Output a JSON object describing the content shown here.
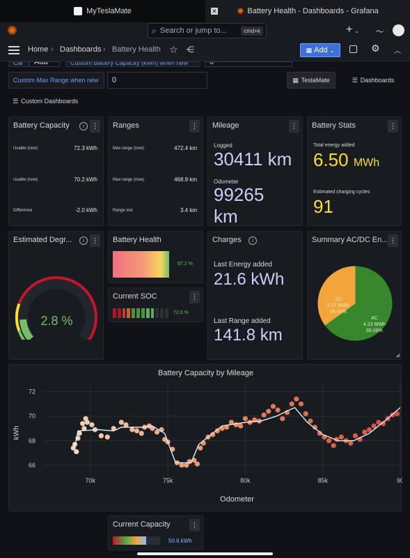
{
  "browser": {
    "tabs": [
      {
        "title": "MyTeslaMate"
      },
      {
        "title": "Battery Health - Dashboards - Grafana"
      }
    ]
  },
  "topnav": {
    "search_placeholder": "Search or jump to...",
    "search_shortcut": "cmd+k",
    "plus": "+"
  },
  "breadcrumb": {
    "home": "Home",
    "dashboards": "Dashboards",
    "current": "Battery Health",
    "add_label": "Add"
  },
  "variables": {
    "partial_label_1": "Car",
    "partial_value_1": "Ada",
    "partial_label_2": "Custom Battery Capacity (kWh) when new",
    "partial_value_2": "0",
    "max_range_label": "Custom Max Range when new",
    "max_range_value": "0",
    "teslamate_link": "TeslaMate",
    "dashboards_link": "Dashboards",
    "custom_dashboards": "Custom Dashboards"
  },
  "battery_capacity": {
    "title": "Battery Capacity",
    "rows": [
      {
        "label": "Usable (new)",
        "value": "72.3 kWh"
      },
      {
        "label": "Usable (now)",
        "value": "70.2 kWh"
      },
      {
        "label": "Difference",
        "value": "-2.0 kWh"
      }
    ]
  },
  "ranges": {
    "title": "Ranges",
    "rows": [
      {
        "label": "Max range (new)",
        "value": "472.4 km"
      },
      {
        "label": "Max range (now)",
        "value": "468.9 km"
      },
      {
        "label": "Range lost",
        "value": "3.4 km"
      }
    ]
  },
  "mileage": {
    "title": "Mileage",
    "logged_label": "Logged",
    "logged_value": "30411 km",
    "odometer_label": "Odometer",
    "odometer_value_1": "99265",
    "odometer_value_2": "km"
  },
  "battery_stats": {
    "title": "Battery Stats",
    "energy_label": "Total energy added",
    "energy_value": "6.50",
    "energy_unit": "MWh",
    "cycles_label": "Estimated charging cycles",
    "cycles_value": "91"
  },
  "degradation": {
    "title": "Estimated Degr...",
    "value": "2.8 %",
    "percent": 2.8
  },
  "battery_health": {
    "title": "Battery Health",
    "value": "97.2 %",
    "percent": 97.2
  },
  "current_soc": {
    "title": "Current SOC",
    "value": "72.0 %",
    "percent": 72.0
  },
  "charges": {
    "title": "Charges",
    "energy_label": "Last Energy added",
    "energy_value": "21.6 kWh",
    "range_label": "Last Range added",
    "range_value": "141.8 km"
  },
  "summary": {
    "title": "Summary AC/DC En...",
    "slices": [
      {
        "name": "AC",
        "value": "4.23 MWh",
        "pct_label": "65.08%",
        "pct": 65.08,
        "color": "#37872d"
      },
      {
        "name": "DC",
        "value": "2.27 MWh",
        "pct_label": "34.92%",
        "pct": 34.92,
        "color": "#f2a53a"
      }
    ]
  },
  "current_capacity": {
    "title": "Current Capacity",
    "value": "50.6 kWh",
    "fraction": 0.7
  },
  "chart_data": {
    "type": "scatter",
    "title": "Battery Capacity by Mileage",
    "xlabel": "Odometer",
    "ylabel": "kWh",
    "x_unit": "km",
    "xlim": [
      67000,
      90000
    ],
    "ylim": [
      65.2,
      72.6
    ],
    "xticks": [
      {
        "v": 70000,
        "label": "70k"
      },
      {
        "v": 75000,
        "label": "75k"
      },
      {
        "v": 80000,
        "label": "80k"
      },
      {
        "v": 85000,
        "label": "85k"
      },
      {
        "v": 90000,
        "label": "90"
      }
    ],
    "yticks": [
      66,
      68,
      70,
      72
    ],
    "grid": true,
    "series": [
      {
        "type": "scatter",
        "points": [
          [
            68900,
            67.4
          ],
          [
            69000,
            67.7
          ],
          [
            69100,
            67.1
          ],
          [
            69200,
            68.2
          ],
          [
            69300,
            68.6
          ],
          [
            69500,
            69.4
          ],
          [
            69600,
            69.0
          ],
          [
            69700,
            69.8
          ],
          [
            69800,
            69.5
          ],
          [
            70100,
            69.3
          ],
          [
            70300,
            68.9
          ],
          [
            70700,
            68.4
          ],
          [
            71100,
            68.3
          ],
          [
            71500,
            69.0
          ],
          [
            72000,
            69.5
          ],
          [
            72300,
            69.3
          ],
          [
            72700,
            68.9
          ],
          [
            73000,
            68.8
          ],
          [
            73300,
            68.6
          ],
          [
            73500,
            69.1
          ],
          [
            73800,
            69.2
          ],
          [
            74000,
            69.0
          ],
          [
            74300,
            68.7
          ],
          [
            74600,
            68.9
          ],
          [
            74800,
            68.1
          ],
          [
            75000,
            67.9
          ],
          [
            75300,
            67.3
          ],
          [
            75600,
            66.2
          ],
          [
            75900,
            66.0
          ],
          [
            76200,
            66.0
          ],
          [
            76400,
            66.3
          ],
          [
            76700,
            66.4
          ],
          [
            76900,
            66.1
          ],
          [
            77100,
            67.4
          ],
          [
            77300,
            67.8
          ],
          [
            77600,
            68.3
          ],
          [
            77900,
            68.5
          ],
          [
            78200,
            68.8
          ],
          [
            78500,
            69.0
          ],
          [
            78800,
            69.1
          ],
          [
            79100,
            69.5
          ],
          [
            79400,
            69.3
          ],
          [
            79700,
            69.2
          ],
          [
            80000,
            69.8
          ],
          [
            80300,
            69.5
          ],
          [
            80600,
            69.7
          ],
          [
            80900,
            69.6
          ],
          [
            81200,
            70.1
          ],
          [
            81500,
            70.4
          ],
          [
            81800,
            70.8
          ],
          [
            82100,
            70.5
          ],
          [
            82400,
            69.8
          ],
          [
            82700,
            70.3
          ],
          [
            83000,
            71.0
          ],
          [
            83300,
            71.4
          ],
          [
            83600,
            71.0
          ],
          [
            83900,
            70.2
          ],
          [
            84200,
            69.6
          ],
          [
            84500,
            69.1
          ],
          [
            84800,
            68.6
          ],
          [
            85100,
            68.3
          ],
          [
            85400,
            68.0
          ],
          [
            85700,
            67.6
          ],
          [
            85900,
            68.1
          ],
          [
            86200,
            68.3
          ],
          [
            86500,
            68.0
          ],
          [
            86800,
            67.8
          ],
          [
            87100,
            68.4
          ],
          [
            87400,
            68.1
          ],
          [
            87700,
            68.7
          ],
          [
            88000,
            68.9
          ],
          [
            88300,
            69.2
          ],
          [
            88600,
            69.5
          ],
          [
            88900,
            69.4
          ],
          [
            89200,
            69.8
          ],
          [
            89500,
            70.1
          ],
          [
            89800,
            70.2
          ]
        ]
      },
      {
        "type": "line",
        "points": [
          [
            69000,
            67.5
          ],
          [
            69200,
            68.8
          ],
          [
            70500,
            68.9
          ],
          [
            71500,
            68.8
          ],
          [
            72000,
            69.1
          ],
          [
            73500,
            69.1
          ],
          [
            74000,
            69.2
          ],
          [
            74800,
            68.6
          ],
          [
            75500,
            66.2
          ],
          [
            76500,
            66.2
          ],
          [
            77000,
            67.7
          ],
          [
            78500,
            69.2
          ],
          [
            80000,
            69.5
          ],
          [
            81000,
            69.6
          ],
          [
            82000,
            70.0
          ],
          [
            83000,
            70.6
          ],
          [
            83200,
            70.7
          ],
          [
            84000,
            69.5
          ],
          [
            85000,
            68.5
          ],
          [
            86000,
            68.0
          ],
          [
            87000,
            68.0
          ],
          [
            88000,
            68.6
          ],
          [
            89000,
            69.6
          ],
          [
            90000,
            70.7
          ]
        ]
      }
    ]
  }
}
